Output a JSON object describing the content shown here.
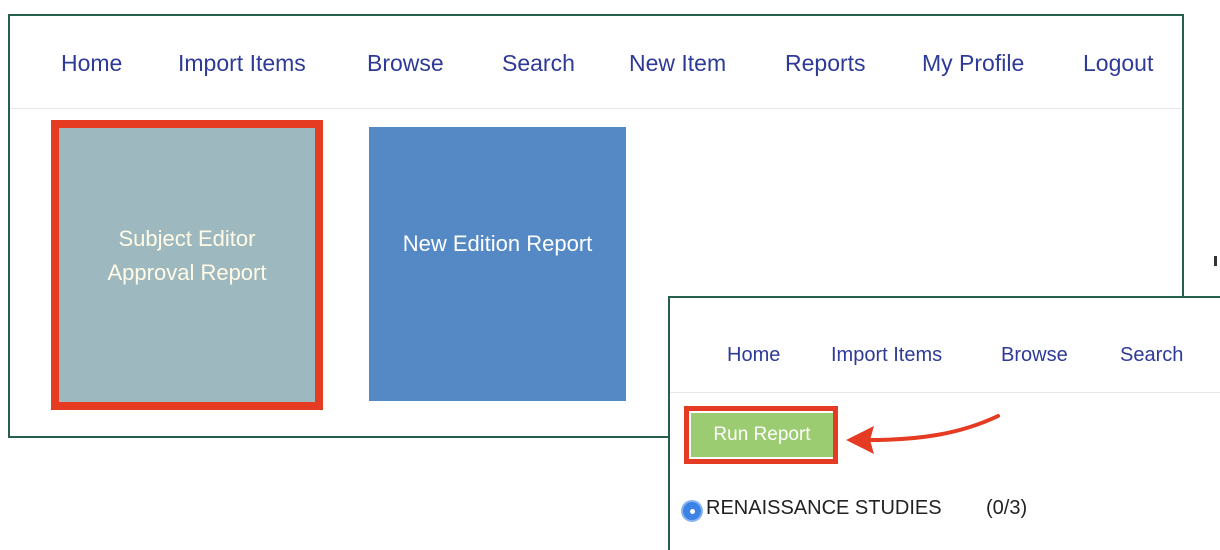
{
  "back_window": {
    "nav": {
      "home": "Home",
      "import_items": "Import Items",
      "browse": "Browse",
      "search": "Search",
      "new_item": "New Item",
      "reports": "Reports",
      "my_profile": "My Profile",
      "logout": "Logout"
    },
    "tiles": {
      "subject_editor_line1": "Subject Editor",
      "subject_editor_line2": "Approval Report",
      "new_edition": "New Edition Report"
    }
  },
  "front_window": {
    "nav": {
      "home": "Home",
      "import_items": "Import Items",
      "browse": "Browse",
      "search": "Search"
    },
    "run_report_label": "Run Report",
    "subject": {
      "name": "RENAISSANCE STUDIES",
      "count": "(0/3)",
      "selected": true
    }
  },
  "colors": {
    "window_border": "#26604a",
    "nav_link": "#2e3a97",
    "highlight": "#e63b23",
    "subject_tile": "#9eb8bf",
    "edition_tile": "#5589c6",
    "run_button": "#9ccc71",
    "radio": "#3d83e6"
  },
  "icons": {
    "annotation_arrow": "red-arrow-icon",
    "radio": "radio-selected-icon"
  }
}
